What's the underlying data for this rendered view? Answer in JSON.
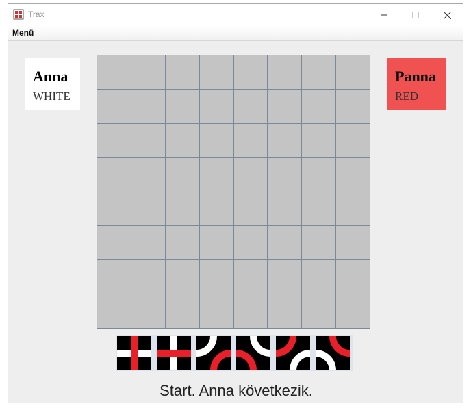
{
  "window": {
    "title": "Trax"
  },
  "menu": {
    "items": [
      "Menü"
    ]
  },
  "players": [
    {
      "name": "Anna",
      "color_label": "WHITE",
      "background": "#ffffff"
    },
    {
      "name": "Panna",
      "color_label": "RED",
      "background": "#f05252"
    }
  ],
  "board": {
    "rows": 8,
    "cols": 8,
    "cell_color": "#c4c4c4",
    "grid_color": "#7a8a99"
  },
  "palette": {
    "tiles": [
      {
        "icon": "cross-tile-red-vertical-icon"
      },
      {
        "icon": "cross-tile-red-horizontal-icon"
      },
      {
        "icon": "curve-tile-white-topleft-red-bottomright-icon"
      },
      {
        "icon": "curve-tile-red-bottomleft-white-topright-icon"
      },
      {
        "icon": "curve-tile-red-topleft-white-bottomright-icon"
      },
      {
        "icon": "curve-tile-white-bottomleft-red-topright-icon"
      }
    ],
    "colors": {
      "red": "#e8202a",
      "white": "#ffffff",
      "black": "#000000"
    }
  },
  "status": {
    "text": "Start. Anna következik."
  }
}
